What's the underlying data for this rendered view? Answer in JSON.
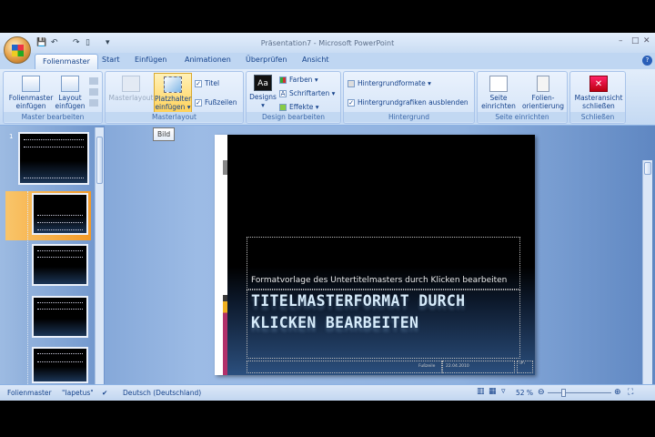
{
  "window": {
    "title": "Präsentation7 - Microsoft PowerPoint",
    "minimize": "–",
    "maximize": "□",
    "close": "✕"
  },
  "quick_access": {
    "save": "💾",
    "undo": "↶",
    "redo": "↷",
    "new": "▯",
    "customize": "▾"
  },
  "tabs": [
    "Folienmaster",
    "Start",
    "Einfügen",
    "Animationen",
    "Überprüfen",
    "Ansicht"
  ],
  "help": "?",
  "ribbon": {
    "master_bearbeiten": {
      "label": "Master bearbeiten",
      "folienmaster_einfuegen": "Folienmaster einfügen",
      "layout_einfuegen": "Layout einfügen"
    },
    "masterlayout": {
      "label": "Masterlayout",
      "masterlayout": "Masterlayout",
      "platzhalter": "Platzhalter einfügen ▾",
      "titel": "Titel",
      "fusszeilen": "Fußzeilen",
      "titel_checked": true,
      "fusszeilen_checked": true
    },
    "design": {
      "label": "Design bearbeiten",
      "designs": "Designs",
      "designs_arrow": "▾",
      "farben": "Farben ▾",
      "schriftarten": "Schriftarten ▾",
      "effekte": "Effekte ▾",
      "aa": "Aa"
    },
    "hintergrund": {
      "label": "Hintergrund",
      "formate": "Hintergrundformate ▾",
      "ausblenden": "Hintergrundgrafiken ausblenden",
      "ausblenden_checked": true
    },
    "seite": {
      "label": "Seite einrichten",
      "seite_einrichten": "Seite einrichten",
      "orientierung": "Folien-orientierung ▾"
    },
    "schliessen": {
      "label": "Schließen",
      "masteransicht": "Masteransicht schließen"
    }
  },
  "tooltip": "Bild",
  "thumbnails": {
    "first_number": "1"
  },
  "slide": {
    "subtitle": "Formatvorlage des Untertitelmasters durch Klicken bearbeiten",
    "title": "TITELMASTERFORMAT DURCH KLICKEN BEARBEITEN",
    "footer": "Fußzeile",
    "date": "22.04.2010",
    "number": "‹#›"
  },
  "status": {
    "view": "Folienmaster",
    "theme": "\"Iapetus\"",
    "language": "Deutsch (Deutschland)",
    "zoom": "52 %",
    "zoom_fraction": 0.52
  }
}
